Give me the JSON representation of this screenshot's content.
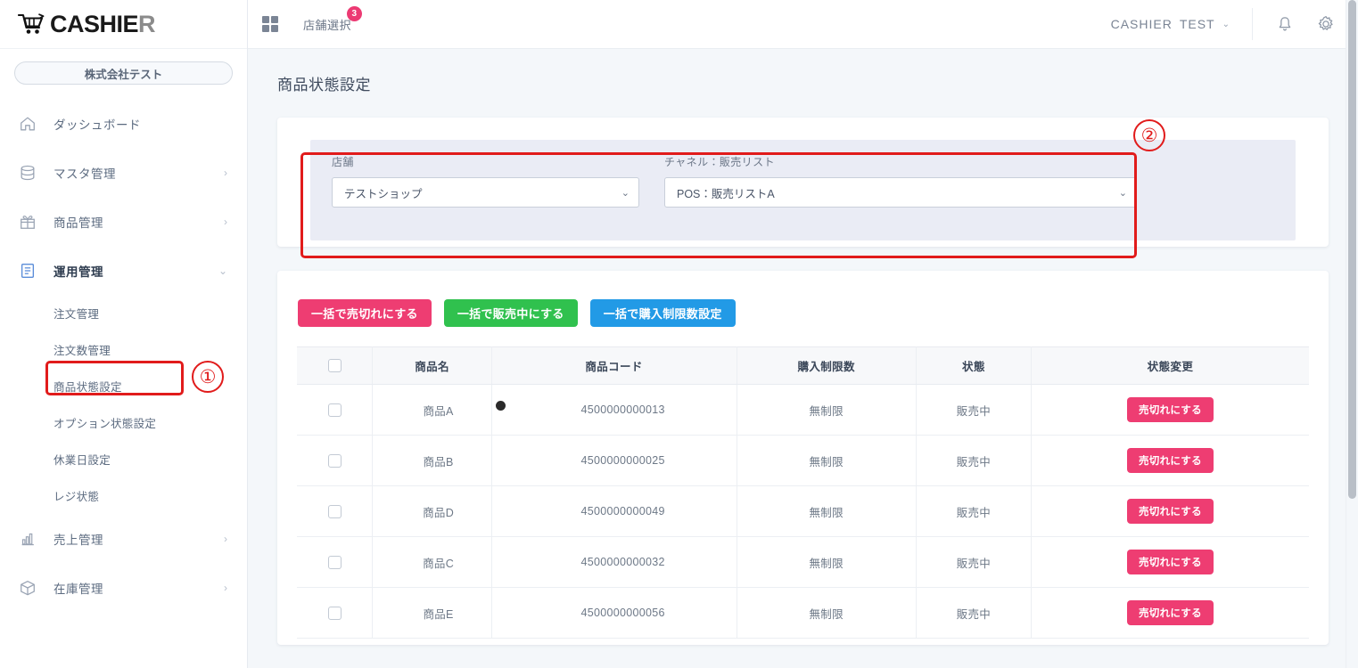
{
  "brand": {
    "name_main": "CASHIE",
    "name_accent": "R",
    "cart_icon": "shopping-cart-icon"
  },
  "sidebar": {
    "company_label": "株式会社テスト",
    "items": [
      {
        "label": "ダッシュボード",
        "icon": "home-icon",
        "chevron": "",
        "active": false
      },
      {
        "label": "マスタ管理",
        "icon": "database-icon",
        "chevron": "›",
        "active": false
      },
      {
        "label": "商品管理",
        "icon": "gift-icon",
        "chevron": "›",
        "active": false
      },
      {
        "label": "運用管理",
        "icon": "clipboard-icon",
        "chevron": "⌄",
        "active": true
      },
      {
        "label": "売上管理",
        "icon": "bar-chart-icon",
        "chevron": "›",
        "active": false
      },
      {
        "label": "在庫管理",
        "icon": "box-icon",
        "chevron": "›",
        "active": false
      }
    ],
    "sub_items": [
      {
        "label": "注文管理"
      },
      {
        "label": "注文数管理"
      },
      {
        "label": "商品状態設定"
      },
      {
        "label": "オプション状態設定"
      },
      {
        "label": "休業日設定"
      },
      {
        "label": "レジ状態"
      }
    ]
  },
  "topbar": {
    "grid_icon": "grid-icon",
    "store_select_label": "店舗選択",
    "store_select_badge": "3",
    "user_org": "CASHIER",
    "user_name": "TEST",
    "user_caret": "⌄",
    "bell_icon": "bell-icon",
    "gear_icon": "gear-icon"
  },
  "page": {
    "title": "商品状態設定"
  },
  "filter": {
    "store": {
      "label": "店舗",
      "value": "テストショップ",
      "arrow": "⌄"
    },
    "channel": {
      "label": "チャネル：販売リスト",
      "value": "POS：販売リストA",
      "arrow": "⌄"
    }
  },
  "bulk_actions": [
    {
      "label": "一括で売切れにする",
      "color": "#ee3d72",
      "style": "btn-pink"
    },
    {
      "label": "一括で販売中にする",
      "color": "#30c14e",
      "style": "btn-green"
    },
    {
      "label": "一括で購入制限数設定",
      "color": "#229ae6",
      "style": "btn-blue"
    }
  ],
  "table": {
    "headers": [
      "",
      "商品名",
      "商品コード",
      "購入制限数",
      "状態",
      "状態変更"
    ],
    "rows": [
      {
        "name": "商品A",
        "code": "4500000000013",
        "limit": "無制限",
        "state": "販売中",
        "action": "売切れにする"
      },
      {
        "name": "商品B",
        "code": "4500000000025",
        "limit": "無制限",
        "state": "販売中",
        "action": "売切れにする"
      },
      {
        "name": "商品D",
        "code": "4500000000049",
        "limit": "無制限",
        "state": "販売中",
        "action": "売切れにする"
      },
      {
        "name": "商品C",
        "code": "4500000000032",
        "limit": "無制限",
        "state": "販売中",
        "action": "売切れにする"
      },
      {
        "name": "商品E",
        "code": "4500000000056",
        "limit": "無制限",
        "state": "販売中",
        "action": "売切れにする"
      }
    ]
  },
  "annotations": [
    {
      "number": "①",
      "target": "sidebar-item-product-status"
    },
    {
      "number": "②",
      "target": "filter-panel"
    }
  ],
  "colors": {
    "accent_pink": "#ee3d72",
    "accent_green": "#30c14e",
    "accent_blue": "#229ae6",
    "annotation_red": "#e11b1b",
    "panel_bg": "#eaecf5",
    "page_bg": "#f4f7fa"
  }
}
